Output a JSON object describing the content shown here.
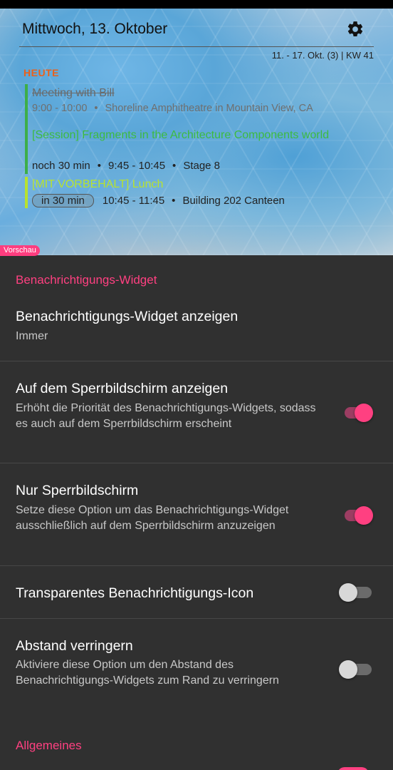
{
  "widget": {
    "date": "Mittwoch, 13. Oktober",
    "week_info": "11. - 17. Okt. (3) | KW 41",
    "today_label": "HEUTE",
    "events": [
      {
        "title": "Meeting with Bill",
        "time": "9:00 - 10:00",
        "location": "Shoreline Amphitheatre in Mountain View, CA"
      },
      {
        "title": "[Session] Fragments in the Architecture Components world",
        "relative": "noch 30 min",
        "time": "9:45 - 10:45",
        "location": "Stage 8"
      },
      {
        "title": "[MIT VORBEHALT] Lunch",
        "relative": "in 30 min",
        "time": "10:45 - 11:45",
        "location": "Building 202 Canteen"
      }
    ],
    "separator": "•",
    "preview_badge": "Vorschau",
    "colors": {
      "past": "#6a6a6a",
      "current": "#3dbb40",
      "upcoming": "#b8e22f",
      "today": "#e8611c"
    }
  },
  "settings": {
    "section_widget": "Benachrichtigungs-Widget",
    "items": [
      {
        "title": "Benachrichtigungs-Widget anzeigen",
        "summary": "Immer"
      },
      {
        "title": "Auf dem Sperrbildschirm anzeigen",
        "summary": "Erhöht die Priorität des Benachrichtigungs-Widgets, sodass es auch auf dem Sperrbildschirm erscheint",
        "checked": true
      },
      {
        "title": "Nur Sperrbildschirm",
        "summary": "Setze diese Option um das Benachrichtigungs-Widget ausschließlich auf dem Sperrbildschirm anzuzeigen",
        "checked": true
      },
      {
        "title": "Transparentes Benachrichtigungs-Icon",
        "checked": false
      },
      {
        "title": "Abstand verringern",
        "summary": "Aktiviere diese Option um den Abstand des Benachrichtigungs-Widgets zum Rand zu verringern",
        "checked": false
      }
    ],
    "section_general": "Allgemeines",
    "accent": "#ff4081"
  }
}
